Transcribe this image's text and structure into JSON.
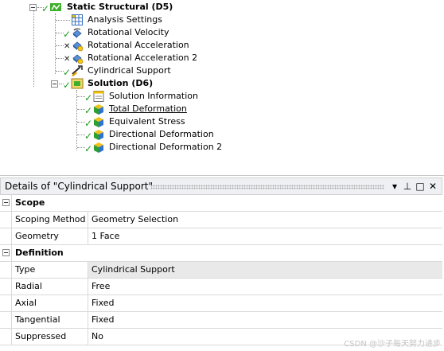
{
  "tree": {
    "root": {
      "label": "Static Structural (D5)",
      "icon": "static-structural-icon",
      "status": "check"
    },
    "children": [
      {
        "label": "Analysis Settings",
        "icon": "analysis-settings-icon",
        "status": "none"
      },
      {
        "label": "Rotational Velocity",
        "icon": "rotational-velocity-icon",
        "status": "check"
      },
      {
        "label": "Rotational Acceleration",
        "icon": "rotational-acceleration-icon",
        "status": "cross"
      },
      {
        "label": "Rotational Acceleration 2",
        "icon": "rotational-acceleration-icon",
        "status": "cross"
      },
      {
        "label": "Cylindrical Support",
        "icon": "cylindrical-support-icon",
        "status": "check"
      }
    ],
    "solution": {
      "label": "Solution (D6)",
      "icon": "solution-icon",
      "status": "check"
    },
    "solution_children": [
      {
        "label": "Solution Information",
        "icon": "solution-information-icon",
        "status": "check"
      },
      {
        "label": "Total Deformation",
        "icon": "result-cube-icon",
        "status": "check"
      },
      {
        "label": "Equivalent Stress",
        "icon": "result-cube-icon",
        "status": "check"
      },
      {
        "label": "Directional Deformation",
        "icon": "result-cube-icon",
        "status": "check"
      },
      {
        "label": "Directional Deformation 2",
        "icon": "result-cube-icon",
        "status": "check"
      }
    ]
  },
  "details": {
    "title": "Details of \"Cylindrical Support\"",
    "buttons": {
      "menu": "▾",
      "pin": "⊥",
      "maximize": "□",
      "close": "✕"
    },
    "sections": [
      {
        "name": "Scope",
        "rows": [
          {
            "key": "Scoping Method",
            "value": "Geometry Selection"
          },
          {
            "key": "Geometry",
            "value": "1 Face"
          }
        ]
      },
      {
        "name": "Definition",
        "rows": [
          {
            "key": "Type",
            "value": "Cylindrical Support"
          },
          {
            "key": "Radial",
            "value": "Free"
          },
          {
            "key": "Axial",
            "value": "Fixed"
          },
          {
            "key": "Tangential",
            "value": "Fixed"
          },
          {
            "key": "Suppressed",
            "value": "No"
          }
        ]
      }
    ]
  },
  "watermark": "CSDN @沙子每天努力进步",
  "colors": {
    "check": "#1a9a1a",
    "header_bg": "#eef0f3",
    "highlight_row": "#e9e9e9"
  }
}
